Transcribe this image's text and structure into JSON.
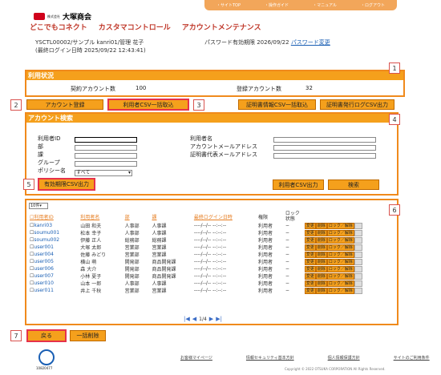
{
  "topnav": [
    "・サイトTOP",
    "・操作ガイド",
    "・マニュアル",
    "・ログアウト"
  ],
  "brand": {
    "name": "大塚商会",
    "small": "株式会社"
  },
  "mainnav": [
    "どこでもコネクト",
    "カスタマコントロール",
    "アカウントメンテナンス"
  ],
  "user": {
    "line1": "YSCTL00002/サンプル kanri01/管理 花子",
    "line2": "(最終ログイン日時 2025/09/22 12:43:41)"
  },
  "password": {
    "label": "パスワード有効期限 2026/09/22",
    "link": "パスワード変更"
  },
  "usage": {
    "title": "利用状況",
    "contract_label": "契約アカウント数",
    "contract_value": "100",
    "registered_label": "登録アカウント数",
    "registered_value": "32"
  },
  "buttons": {
    "register": "アカウント登録",
    "csv_import": "利用者CSV一括取込",
    "cert_import": "証明書情報CSV一括取込",
    "cert_log": "証明書発行ログCSV出力",
    "expire_csv": "有効期限CSV出力",
    "user_csv": "利用者CSV出力",
    "search": "検索",
    "back": "戻る",
    "bulk_delete": "一括削除"
  },
  "search": {
    "title": "アカウント検索",
    "left_labels": [
      "利用者ID",
      "部",
      "課",
      "グループ",
      "ポリシー名"
    ],
    "right_labels": [
      "利用者名",
      "アカウントメールアドレス",
      "証明書代表メールアドレス"
    ],
    "policy_value": "すべて"
  },
  "callouts": [
    "1",
    "2",
    "3",
    "4",
    "5",
    "6",
    "7"
  ],
  "list": {
    "perpage": "10件",
    "headers": [
      "利用者ID",
      "利用者名",
      "部",
      "課",
      "最終ログイン日時",
      "権限",
      "ロック状態"
    ],
    "rows": [
      {
        "id": "kanri03",
        "name": "山田 和夫",
        "dept": "人事部",
        "sect": "人事課",
        "last": "----/--/-- --:--:--",
        "role": "利用者",
        "lock": "−"
      },
      {
        "id": "soumu001",
        "name": "松本 幸子",
        "dept": "人事部",
        "sect": "人事課",
        "last": "----/--/-- --:--:--",
        "role": "利用者",
        "lock": "−"
      },
      {
        "id": "soumu002",
        "name": "伊藤 正人",
        "dept": "総務部",
        "sect": "総務課",
        "last": "----/--/-- --:--:--",
        "role": "利用者",
        "lock": "−"
      },
      {
        "id": "user001",
        "name": "大塚 太郎",
        "dept": "営業部",
        "sect": "営業課",
        "last": "----/--/-- --:--:--",
        "role": "利用者",
        "lock": "−"
      },
      {
        "id": "user004",
        "name": "佐藤 みどり",
        "dept": "営業部",
        "sect": "営業課",
        "last": "----/--/-- --:--:--",
        "role": "利用者",
        "lock": "−"
      },
      {
        "id": "user005",
        "name": "横山 萌",
        "dept": "開発部",
        "sect": "商品開発課",
        "last": "----/--/-- --:--:--",
        "role": "利用者",
        "lock": "−"
      },
      {
        "id": "user006",
        "name": "森 大介",
        "dept": "開発部",
        "sect": "商品開発課",
        "last": "----/--/-- --:--:--",
        "role": "利用者",
        "lock": "−"
      },
      {
        "id": "user007",
        "name": "小林 夏子",
        "dept": "開発部",
        "sect": "商品開発課",
        "last": "----/--/-- --:--:--",
        "role": "利用者",
        "lock": "−"
      },
      {
        "id": "user010",
        "name": "山本 一郎",
        "dept": "人事部",
        "sect": "人事課",
        "last": "----/--/-- --:--:--",
        "role": "利用者",
        "lock": "−"
      },
      {
        "id": "user011",
        "name": "井上 千秋",
        "dept": "営業部",
        "sect": "営業課",
        "last": "----/--/-- --:--:--",
        "role": "利用者",
        "lock": "−"
      }
    ],
    "row_actions": [
      "変更",
      "削除",
      "ロック／解除"
    ],
    "pager": "1/4"
  },
  "footer": {
    "links": [
      "お客様マイページ",
      "情報セキュリティ基本方針",
      "個人情報保護方針",
      "サイトのご利用条件"
    ],
    "copyright": "Copyright © 2022 OTSUKA CORPORATION All Rights Reserved.",
    "privacy_no": "10820477"
  }
}
